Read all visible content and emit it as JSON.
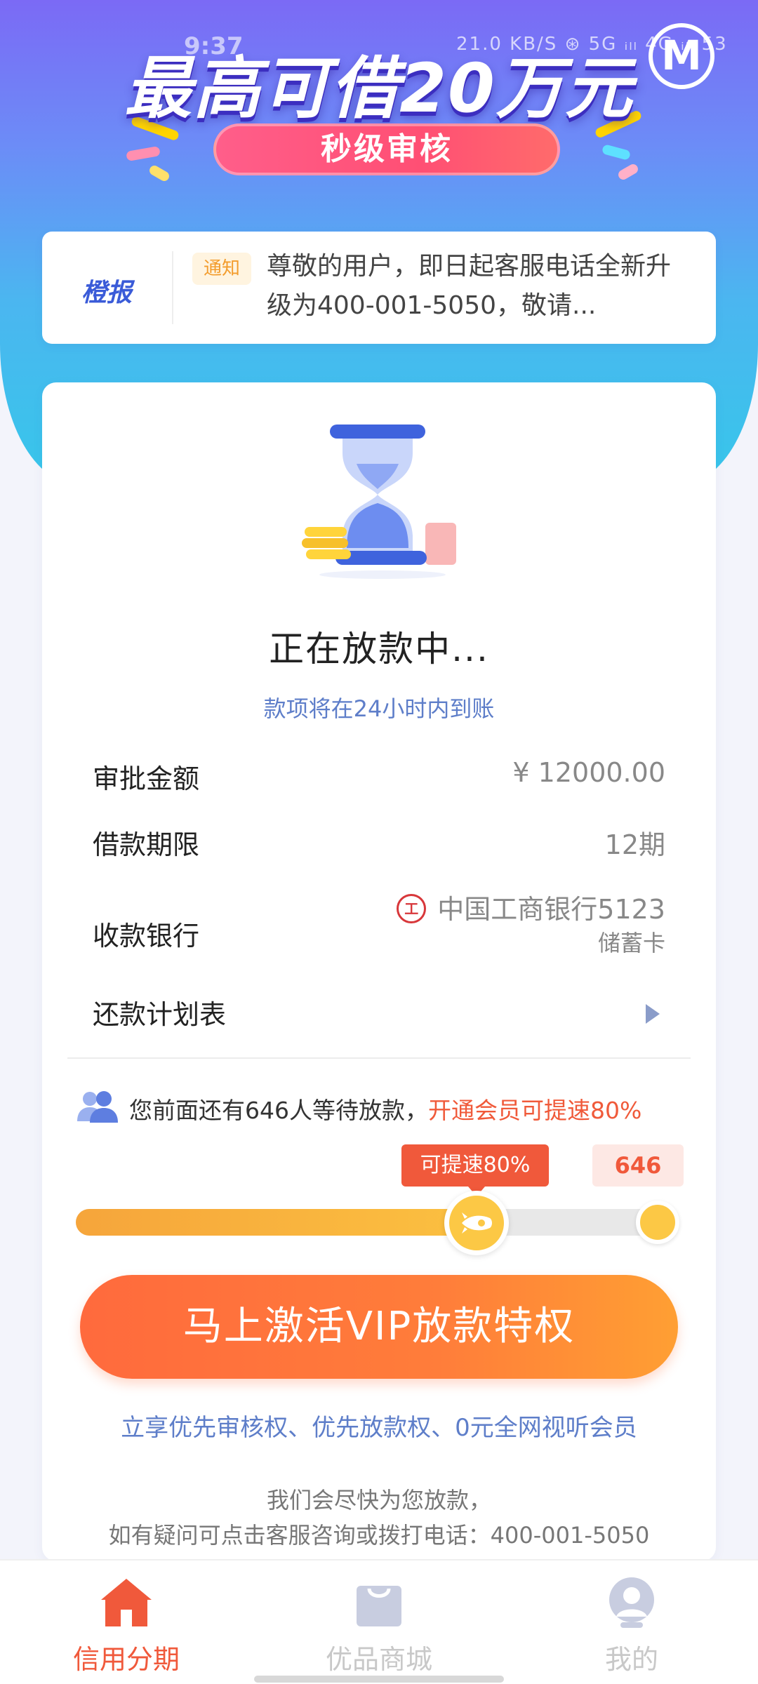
{
  "status_bar": {
    "time": "9:37",
    "right": "21.0 KB/S ⊛ 5G ᵢₗₗ 4G ᵢₗₗ 53"
  },
  "hero": {
    "title": "最高可借20万元",
    "subtitle": "秒级审核",
    "logo": "M"
  },
  "notice": {
    "brand": "橙报",
    "tag": "通知",
    "text": "尊敬的用户，即日起客服电话全新升级为400-001-5050，敬请..."
  },
  "loan_status": {
    "title": "正在放款中...",
    "description": "款项将在24小时内到账"
  },
  "details": {
    "approved_amount": {
      "label": "审批金额",
      "value": "¥ 12000.00"
    },
    "term": {
      "label": "借款期限",
      "value": "12期"
    },
    "bank": {
      "label": "收款银行",
      "value": "中国工商银行5123",
      "sub": "储蓄卡",
      "icon": "icbc-logo-icon"
    },
    "schedule": {
      "label": "还款计划表"
    }
  },
  "queue": {
    "text": "您前面还有646人等待放款，",
    "highlight": "开通会员可提速80%",
    "speed_tag": "可提速80%",
    "count": "646",
    "progress": 0.64
  },
  "cta": {
    "label": "马上激活VIP放款特权"
  },
  "benefits": "立享优先审核权、优先放款权、0元全网视听会员",
  "footer": {
    "line1": "我们会尽快为您放款，",
    "line2": "如有疑问可点击客服咨询或拨打电话：400-001-5050"
  },
  "tabs": [
    {
      "label": "信用分期",
      "icon": "home-icon",
      "active": true
    },
    {
      "label": "优品商城",
      "icon": "shopping-bag-icon",
      "active": false
    },
    {
      "label": "我的",
      "icon": "profile-icon",
      "active": false
    }
  ],
  "colors": {
    "accent": "#f0593b",
    "link": "#5e7ec9",
    "progress": "#fbbf40",
    "tab_active": "#f0593b",
    "tab_inactive": "#c8c8c8"
  }
}
